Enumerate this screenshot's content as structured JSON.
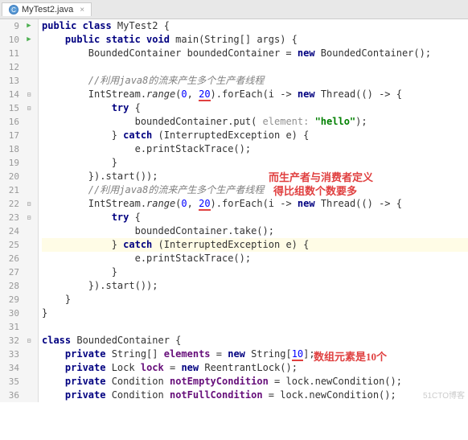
{
  "tab": {
    "filename": "MyTest2.java",
    "close": "×"
  },
  "gutter": {
    "start": 9,
    "end": 36
  },
  "code": {
    "l9": {
      "kw1": "public class",
      "name": " MyTest2 {"
    },
    "l10": {
      "kw1": "public static void",
      "sig": " main(String[] args) {"
    },
    "l11": {
      "t1": "BoundedContainer boundedContainer = ",
      "kw": "new",
      "t2": " BoundedContainer();"
    },
    "l13": {
      "c": "//利用java8的流来产生多个生产者线程"
    },
    "l14": {
      "t1": "IntStream.",
      "m": "range",
      "t2": "(",
      "n1": "0",
      "t3": ", ",
      "n2": "20",
      "t4": ").forEach(i -> ",
      "kw": "new",
      "t5": " Thread(() -> {"
    },
    "l15": {
      "kw": "try",
      "t": " {"
    },
    "l16": {
      "t1": "boundedContainer.put( ",
      "hint": "element:",
      "sp": " ",
      "s": "\"hello\"",
      "t2": ");"
    },
    "l17": {
      "t1": "} ",
      "kw": "catch",
      "t2": " (InterruptedException e) {"
    },
    "l18": {
      "t": "e.printStackTrace();"
    },
    "l19": {
      "t": "}"
    },
    "l20": {
      "t": "}).start());"
    },
    "l21": {
      "c": "//利用java8的流来产生多个生产者线程"
    },
    "l22": {
      "t1": "IntStream.",
      "m": "range",
      "t2": "(",
      "n1": "0",
      "t3": ", ",
      "n2": "20",
      "t4": ").forEach(i -> ",
      "kw": "new",
      "t5": " Thread(() -> {"
    },
    "l23": {
      "kw": "try",
      "t": " {"
    },
    "l24": {
      "t": "boundedContainer.take();"
    },
    "l25": {
      "t1": "} ",
      "kw": "catch",
      "t2": " (InterruptedException e) {"
    },
    "l26": {
      "t": "e.printStackTrace();"
    },
    "l27": {
      "t": "}"
    },
    "l28": {
      "t": "}).start());"
    },
    "l29": {
      "t": "}"
    },
    "l30": {
      "t": "}"
    },
    "l32": {
      "kw": "class",
      "t": " BoundedContainer {"
    },
    "l33": {
      "kw1": "private",
      "t1": " String[] ",
      "f": "elements",
      "t2": " = ",
      "kw2": "new",
      "t3": " String[",
      "n": "10",
      "t4": "];"
    },
    "l34": {
      "kw1": "private",
      "t1": " Lock ",
      "f": "lock",
      "t2": " = ",
      "kw2": "new",
      "t3": " ReentrantLock();"
    },
    "l35": {
      "kw1": "private",
      "t1": " Condition ",
      "f": "notEmptyCondition",
      "t2": " = lock.newCondition();"
    },
    "l36": {
      "kw1": "private",
      "t1": " Condition ",
      "f": "notFullCondition",
      "t2": " = lock.newCondition();"
    }
  },
  "annotations": {
    "a1_line1": "而生产者与消费者定义",
    "a1_line2": "得比组数个数要多",
    "a2": "数组元素是10个"
  },
  "watermark": "51CTO博客"
}
